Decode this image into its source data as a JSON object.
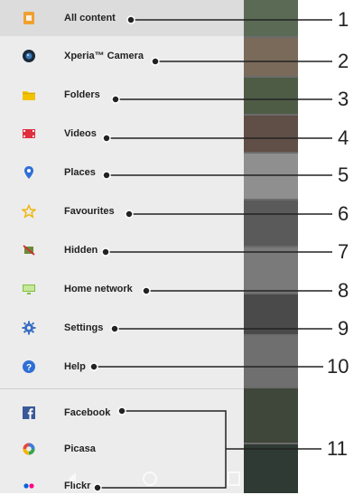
{
  "menu": {
    "items": [
      {
        "label": "All content",
        "icon": "all-content-icon",
        "callout": "1"
      },
      {
        "label": "Xperia™ Camera",
        "icon": "camera-icon",
        "callout": "2"
      },
      {
        "label": "Folders",
        "icon": "folder-icon",
        "callout": "3"
      },
      {
        "label": "Videos",
        "icon": "video-icon",
        "callout": "4"
      },
      {
        "label": "Places",
        "icon": "map-pin-icon",
        "callout": "5"
      },
      {
        "label": "Favourites",
        "icon": "star-icon",
        "callout": "6"
      },
      {
        "label": "Hidden",
        "icon": "hidden-icon",
        "callout": "7"
      },
      {
        "label": "Home network",
        "icon": "home-network-icon",
        "callout": "8"
      },
      {
        "label": "Settings",
        "icon": "gear-icon",
        "callout": "9"
      },
      {
        "label": "Help",
        "icon": "help-icon",
        "callout": "10"
      }
    ],
    "services": [
      {
        "label": "Facebook",
        "icon": "facebook-icon"
      },
      {
        "label": "Picasa",
        "icon": "picasa-icon"
      },
      {
        "label": "Flickr",
        "icon": "flickr-icon"
      }
    ],
    "services_callout": "11"
  },
  "colors": {
    "drawer_bg": "#ececec",
    "selected_bg": "#dcdcdc",
    "accent_orange": "#f0a030",
    "folder_yellow": "#f2c200",
    "video_red": "#e03040",
    "places_blue": "#2e6fd6",
    "star_yellow": "#f0b400",
    "facebook_blue": "#3b5998"
  }
}
